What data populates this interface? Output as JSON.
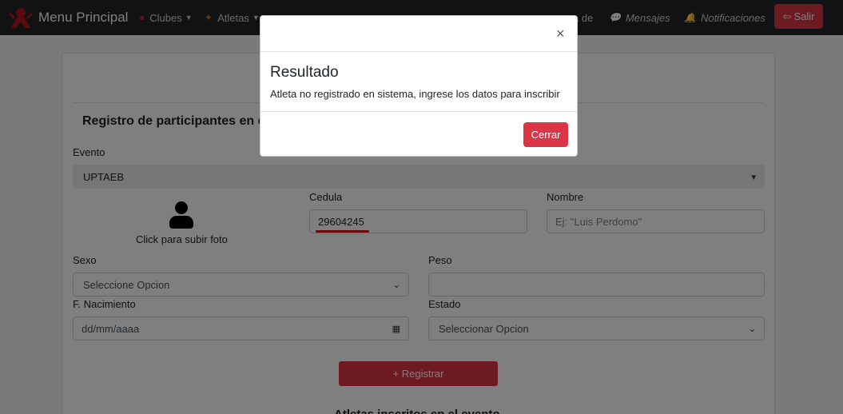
{
  "navbar": {
    "brand": "Menu Principal",
    "items": [
      {
        "label": "Clubes",
        "icon": "boxing-glove-icon"
      },
      {
        "label": "Atletas",
        "icon": "athlete-icon"
      },
      {
        "label": "Mensajes",
        "icon": "chat-icon"
      },
      {
        "label": "Notificaciones",
        "icon": "bell-icon"
      }
    ],
    "partial_visible": {
      "item_end": "a de"
    },
    "logout": "Salir",
    "logout_icon": "logout-icon"
  },
  "form": {
    "heading": "Registro de participantes en ev",
    "evento_label": "Evento",
    "evento_value": "UPTAEB",
    "upload_label": "Click para subir foto",
    "cedula_label": "Cedula",
    "cedula_value": "29604245",
    "nombre_label": "Nombre",
    "nombre_placeholder": "Ej: \"Luis Perdomo\"",
    "sexo_label": "Sexo",
    "sexo_value": "Seleccione Opcion",
    "peso_label": "Peso",
    "nacimiento_label": "F. Nacimiento",
    "nacimiento_placeholder": "dd/mm/aaaa",
    "estado_label": "Estado",
    "estado_value": "Seleccionar Opcion",
    "submit": "+ Registrar",
    "inscritos_heading": "Atletas inscritos en el evento"
  },
  "modal": {
    "title": "Resultado",
    "message": "Atleta no registrado en sistema, ingrese los datos para inscribir",
    "close_icon": "×",
    "button": "Cerrar"
  },
  "colors": {
    "navbar": "#212529",
    "accent": "#dc3545",
    "underline": "#d9141e"
  }
}
